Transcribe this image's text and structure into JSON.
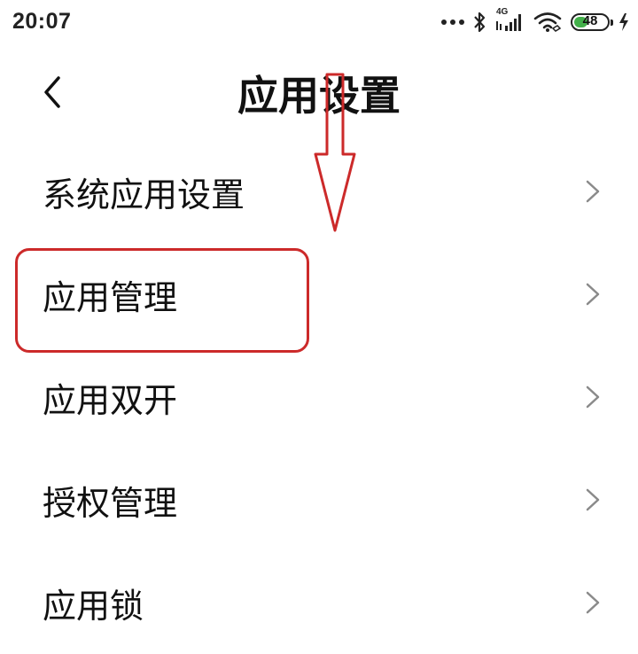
{
  "status_bar": {
    "time": "20:07",
    "network_type": "4G",
    "battery_level": "48",
    "battery_fraction": 0.48,
    "battery_color": "#43b04a",
    "icons": [
      "more-dots-icon",
      "bluetooth-icon",
      "cellular-signal-icon",
      "wifi-icon",
      "battery-icon",
      "charging-bolt-icon"
    ]
  },
  "header": {
    "back_icon": "chevron-left-icon",
    "title": "应用设置"
  },
  "settings_list": {
    "items": [
      {
        "label": "系统应用设置"
      },
      {
        "label": "应用管理"
      },
      {
        "label": "应用双开"
      },
      {
        "label": "授权管理"
      },
      {
        "label": "应用锁"
      }
    ]
  },
  "annotation": {
    "color": "#cc2a2a",
    "highlighted_item": "应用管理"
  }
}
